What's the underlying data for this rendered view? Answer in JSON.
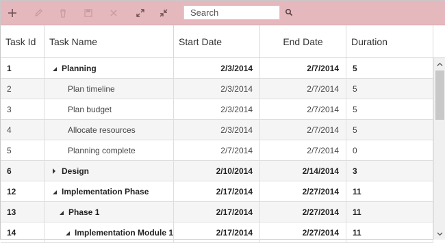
{
  "toolbar": {
    "buttons": [
      {
        "name": "add-icon"
      },
      {
        "name": "edit-icon"
      },
      {
        "name": "delete-icon"
      },
      {
        "name": "save-icon"
      },
      {
        "name": "cancel-icon"
      },
      {
        "name": "expand-all-icon"
      },
      {
        "name": "collapse-all-icon"
      }
    ],
    "search_placeholder": "Search",
    "accent_color": "#e5b8bd"
  },
  "grid": {
    "columns": [
      "Task Id",
      "Task Name",
      "Start Date",
      "End Date",
      "Duration"
    ],
    "rows": [
      {
        "id": "1",
        "name": "Planning",
        "start": "2/3/2014",
        "end": "2/7/2014",
        "duration": "5",
        "parent": true,
        "expanded": true
      },
      {
        "id": "2",
        "name": "Plan timeline",
        "start": "2/3/2014",
        "end": "2/7/2014",
        "duration": "5",
        "parent": false
      },
      {
        "id": "3",
        "name": "Plan budget",
        "start": "2/3/2014",
        "end": "2/7/2014",
        "duration": "5",
        "parent": false
      },
      {
        "id": "4",
        "name": "Allocate resources",
        "start": "2/3/2014",
        "end": "2/7/2014",
        "duration": "5",
        "parent": false
      },
      {
        "id": "5",
        "name": "Planning complete",
        "start": "2/7/2014",
        "end": "2/7/2014",
        "duration": "0",
        "parent": false
      },
      {
        "id": "6",
        "name": "Design",
        "start": "2/10/2014",
        "end": "2/14/2014",
        "duration": "3",
        "parent": true,
        "expanded": false
      },
      {
        "id": "12",
        "name": "Implementation Phase",
        "start": "2/17/2014",
        "end": "2/27/2014",
        "duration": "11",
        "parent": true,
        "expanded": true
      },
      {
        "id": "13",
        "name": "Phase 1",
        "start": "2/17/2014",
        "end": "2/27/2014",
        "duration": "11",
        "parent": true,
        "expanded": true
      },
      {
        "id": "14",
        "name": "Implementation Module 1",
        "start": "2/17/2014",
        "end": "2/27/2014",
        "duration": "11",
        "parent": true,
        "expanded": true
      }
    ]
  }
}
